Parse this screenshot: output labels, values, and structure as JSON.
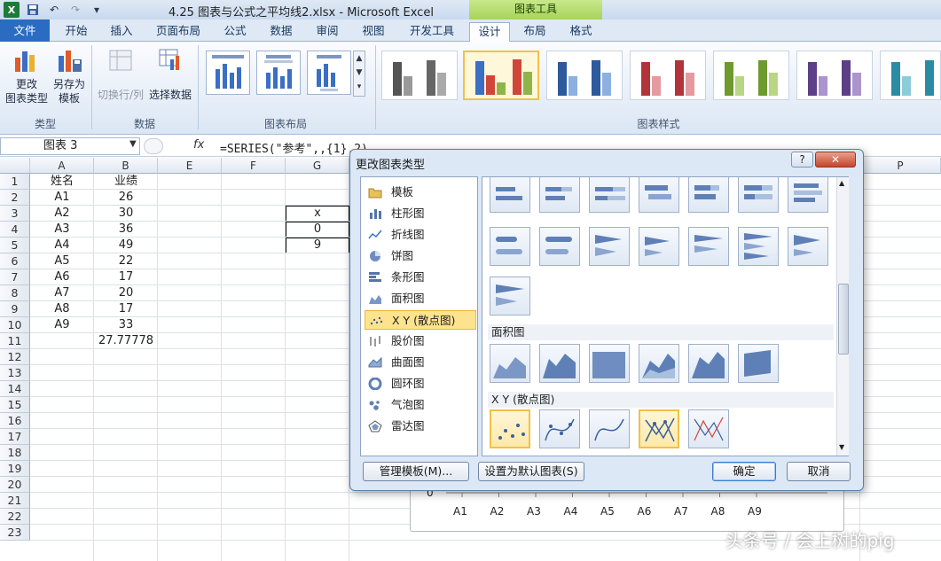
{
  "window": {
    "title": "4.25 图表与公式之平均线2.xlsx  -  Microsoft Excel",
    "contextual_tab_group": "图表工具"
  },
  "ribbon": {
    "tabs": [
      "文件",
      "开始",
      "插入",
      "页面布局",
      "公式",
      "数据",
      "审阅",
      "视图",
      "开发工具",
      "设计",
      "布局",
      "格式"
    ],
    "active_tab": "设计",
    "groups": {
      "type": {
        "label": "类型",
        "change_type_line1": "更改",
        "change_type_line2": "图表类型",
        "save_template_line1": "另存为",
        "save_template_line2": "模板"
      },
      "data": {
        "label": "数据",
        "switch_row_col": "切换行/列",
        "select_data": "选择数据"
      },
      "layout": {
        "label": "图表布局"
      },
      "styles": {
        "label": "图表样式"
      }
    }
  },
  "formula_bar": {
    "name_box": "图表 3",
    "fx": "fx",
    "formula": "=SERIES(\"参考\",,{1},2)"
  },
  "sheet": {
    "columns": [
      "A",
      "B",
      "E",
      "F",
      "G",
      "P"
    ],
    "rows": [
      "1",
      "2",
      "3",
      "4",
      "5",
      "6",
      "7",
      "8",
      "9",
      "10",
      "11",
      "12",
      "13",
      "14",
      "15",
      "16",
      "17",
      "18",
      "19",
      "20",
      "21",
      "22",
      "23"
    ],
    "header": {
      "name": "姓名",
      "score": "业绩"
    },
    "data": [
      {
        "name": "A1",
        "score": "26"
      },
      {
        "name": "A2",
        "score": "30"
      },
      {
        "name": "A3",
        "score": "36"
      },
      {
        "name": "A4",
        "score": "49"
      },
      {
        "name": "A5",
        "score": "22"
      },
      {
        "name": "A6",
        "score": "17"
      },
      {
        "name": "A7",
        "score": "20"
      },
      {
        "name": "A8",
        "score": "17"
      },
      {
        "name": "A9",
        "score": "33"
      }
    ],
    "average": "27.77778",
    "g_cells": [
      "x",
      "0",
      "9"
    ],
    "chart_axis": {
      "zero": "0",
      "categories": [
        "A1",
        "A2",
        "A3",
        "A4",
        "A5",
        "A6",
        "A7",
        "A8",
        "A9"
      ]
    }
  },
  "dialog": {
    "title": "更改图表类型",
    "help": "?",
    "close": "✕",
    "chart_types": [
      {
        "label": "模板",
        "icon": "folder-icon"
      },
      {
        "label": "柱形图",
        "icon": "column-chart-icon"
      },
      {
        "label": "折线图",
        "icon": "line-chart-icon"
      },
      {
        "label": "饼图",
        "icon": "pie-chart-icon"
      },
      {
        "label": "条形图",
        "icon": "bar-chart-icon"
      },
      {
        "label": "面积图",
        "icon": "area-chart-icon"
      },
      {
        "label": "X Y (散点图)",
        "icon": "scatter-chart-icon"
      },
      {
        "label": "股价图",
        "icon": "stock-chart-icon"
      },
      {
        "label": "曲面图",
        "icon": "surface-chart-icon"
      },
      {
        "label": "圆环图",
        "icon": "doughnut-chart-icon"
      },
      {
        "label": "气泡图",
        "icon": "bubble-chart-icon"
      },
      {
        "label": "雷达图",
        "icon": "radar-chart-icon"
      }
    ],
    "selected_type": "X Y (散点图)",
    "sections": {
      "area": "面积图",
      "scatter": "X Y (散点图)"
    },
    "buttons": {
      "manage_templates": "管理模板(M)...",
      "set_default": "设置为默认图表(S)",
      "ok": "确定",
      "cancel": "取消"
    }
  },
  "watermark": "头条号 / 会上树的pig",
  "colors": {
    "accent": "#2a6cc2",
    "chart_tools": "#a8d35a",
    "selection": "#fde38e"
  }
}
